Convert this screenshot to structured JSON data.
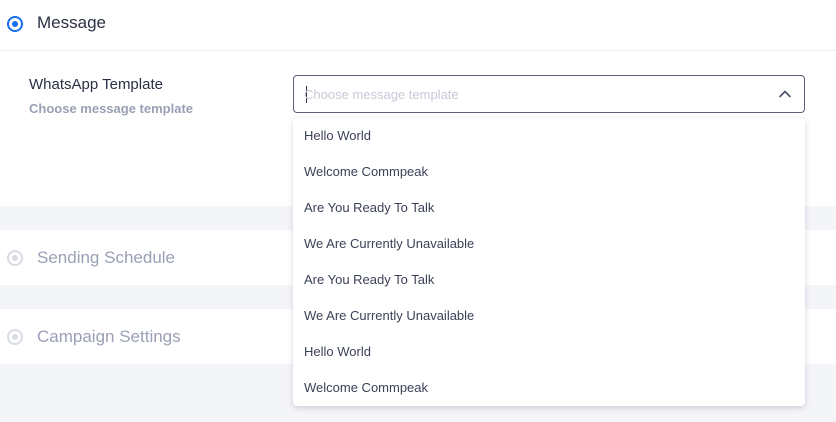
{
  "sections": {
    "message": {
      "title": "Message",
      "active": true
    },
    "schedule": {
      "title": "Sending Schedule",
      "active": false
    },
    "campaign": {
      "title": "Campaign Settings",
      "active": false
    }
  },
  "template_field": {
    "label": "WhatsApp Template",
    "hint": "Choose message template",
    "placeholder": "Choose message template",
    "value": ""
  },
  "dropdown": {
    "options": [
      "Hello World",
      "Welcome Commpeak",
      "Are You Ready To Talk",
      "We Are Currently Unavailable",
      "Are You Ready To Talk",
      "We Are Currently Unavailable",
      "Hello World",
      "Welcome Commpeak"
    ]
  },
  "icons": {
    "radio_active": "radio-selected-icon",
    "radio_inactive": "radio-unselected-icon",
    "chevron": "chevron-up-icon"
  },
  "colors": {
    "accent": "#1a6cf0",
    "text": "#2a3042",
    "muted": "#9aa0b5",
    "background": "#f4f5f9"
  }
}
